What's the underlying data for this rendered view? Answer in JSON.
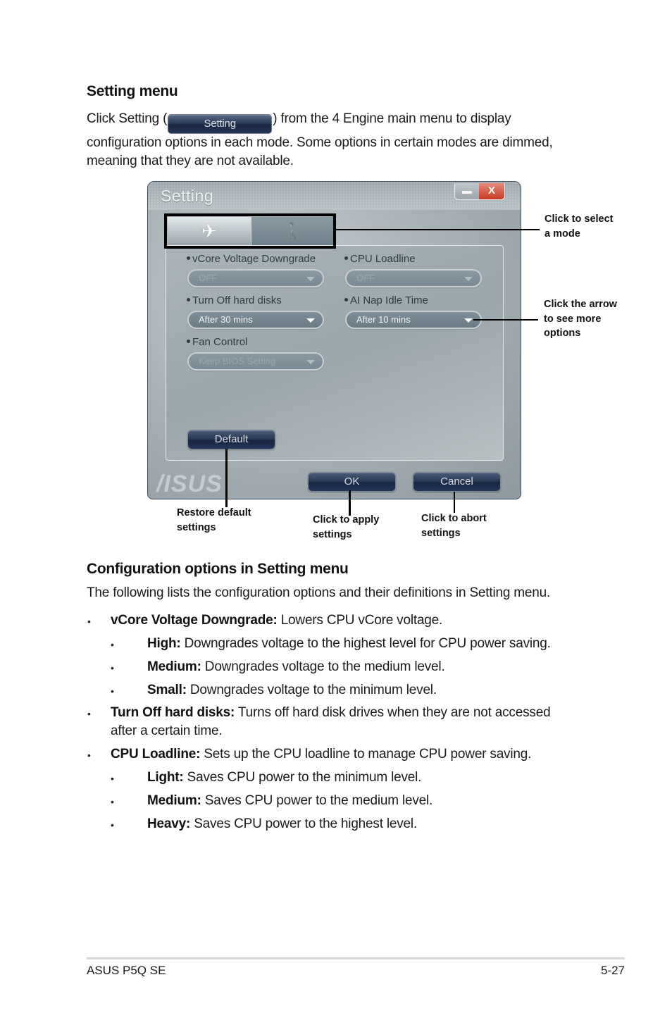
{
  "section1": {
    "heading": "Setting menu",
    "intro_before": "Click Setting (",
    "inline_button_label": "Setting",
    "intro_after": ") from the 4 Engine main menu to display",
    "intro_line2": "configuration options in each mode. Some options in certain modes are dimmed,",
    "intro_line3": "meaning that they are not available."
  },
  "window": {
    "title": "Setting",
    "close_glyph": "X",
    "tabs": [
      {
        "icon": "airplane-icon",
        "glyph": "✈",
        "active": true
      },
      {
        "icon": "walking-person-icon",
        "glyph": "🚶",
        "active": false
      }
    ],
    "options": [
      {
        "label": "vCore Voltage Downgrade",
        "value": "OFF",
        "dimmed": true
      },
      {
        "label": "CPU Loadline",
        "value": "OFF",
        "dimmed": true
      },
      {
        "label": "Turn Off hard disks",
        "value": "After 30 mins",
        "dimmed": false
      },
      {
        "label": "AI Nap Idle Time",
        "value": "After 10 mins",
        "dimmed": false
      },
      {
        "label": "Fan Control",
        "value": "Keep BIOS Setting",
        "dimmed": true
      }
    ],
    "default_button": "Default",
    "ok_button": "OK",
    "cancel_button": "Cancel",
    "brand_logo": "/ISUS"
  },
  "callouts": {
    "mode": [
      "Click to select",
      "a mode"
    ],
    "arrow": [
      "Click the arrow",
      "to see more",
      "options"
    ],
    "default": [
      "Restore default",
      "settings"
    ],
    "ok": [
      "Click to apply",
      "settings"
    ],
    "cancel": [
      "Click to abort",
      "settings"
    ]
  },
  "section2": {
    "heading": "Configuration options in Setting menu",
    "intro": "The following lists the configuration options and their definitions in Setting menu.",
    "items": [
      {
        "term": "vCore Voltage Downgrade:",
        "desc": " Lowers CPU vCore voltage.",
        "sub": [
          {
            "term": "High:",
            "desc": " Downgrades voltage to the highest level for CPU power saving."
          },
          {
            "term": "Medium:",
            "desc": " Downgrades voltage to the medium level."
          },
          {
            "term": "Small:",
            "desc": " Downgrades voltage to the minimum level."
          }
        ]
      },
      {
        "term": "Turn Off hard disks:",
        "desc": " Turns off hard disk drives when they are not accessed",
        "desc_line2": "after a certain time."
      },
      {
        "term": "CPU Loadline:",
        "desc": " Sets up the CPU loadline to manage CPU power saving.",
        "sub": [
          {
            "term": "Light:",
            "desc": " Saves CPU power to the minimum level."
          },
          {
            "term": "Medium:",
            "desc": " Saves CPU power to the medium level."
          },
          {
            "term": "Heavy:",
            "desc": " Saves CPU power to the highest level."
          }
        ]
      }
    ],
    "bullet_glyph": "•"
  },
  "footer": {
    "product": "ASUS P5Q SE",
    "page": "5-27"
  }
}
